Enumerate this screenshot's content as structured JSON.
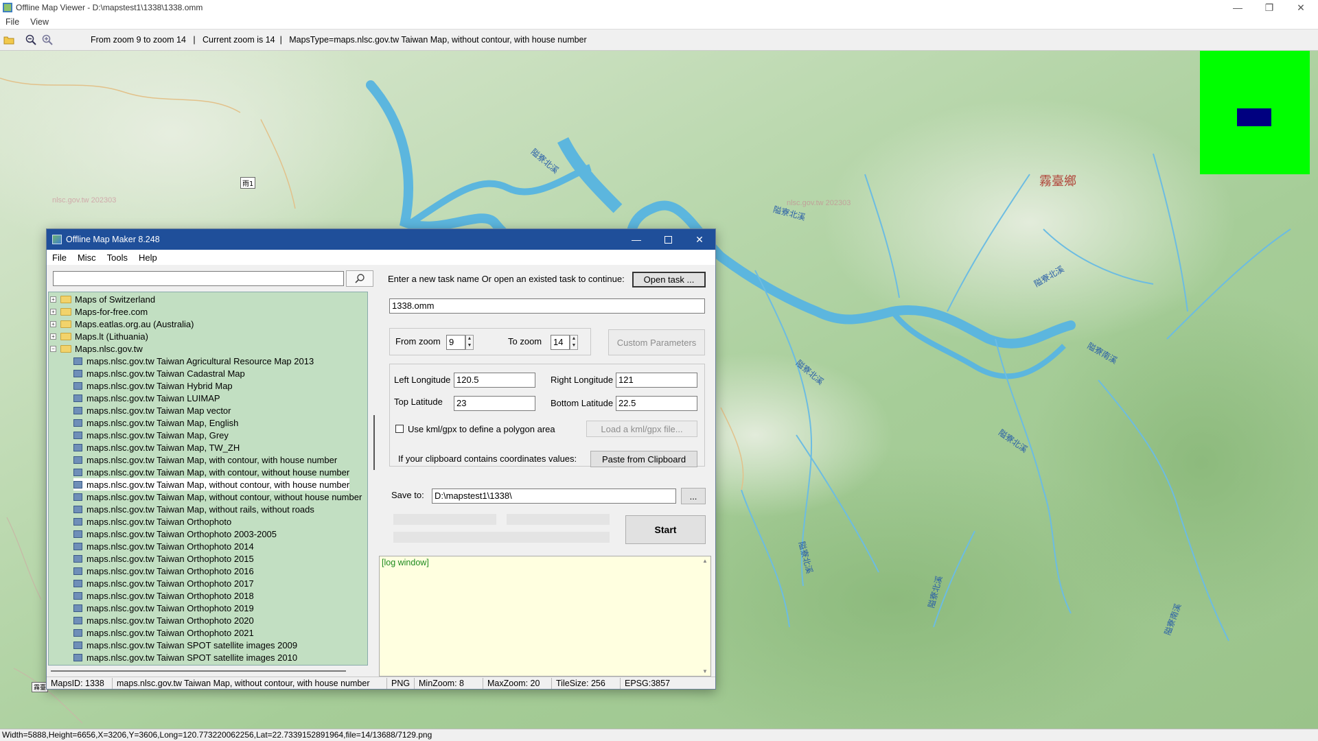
{
  "window": {
    "title": "Offline Map Viewer - D:\\mapstest1\\1338\\1338.omm",
    "min": "—",
    "max": "❐",
    "close": "✕"
  },
  "menu": [
    "File",
    "View"
  ],
  "toolbar": {
    "info": "From zoom 9 to zoom 14   |   Current zoom is 14  |   MapsType=maps.nlsc.gov.tw Taiwan Map, without contour, with house number"
  },
  "status": "Width=5888,Height=6656,X=3206,Y=3606,Long=120.773220062256,Lat=22.7339152891964,file=14/13688/7129.png",
  "map": {
    "labels": [
      "霧臺鄉",
      "隘寮北溪",
      "隘寮北溪",
      "隘寮北溪",
      "隘寮北溪",
      "隘寮北溪",
      "隘寮北溪",
      "隘寮北溪",
      "隘寮南溪",
      "隘寮南溪"
    ],
    "watermarks": [
      "nlsc.gov.tw 202303",
      "nlsc.gov.tw 202303"
    ],
    "road": "雨1",
    "road2": "霧臺"
  },
  "dialog": {
    "title": "Offline Map Maker 8.248",
    "menu": [
      "File",
      "Misc",
      "Tools",
      "Help"
    ],
    "search_value": "",
    "tree": [
      {
        "label": "Maps of Switzerland",
        "type": "folder"
      },
      {
        "label": "Maps-for-free.com",
        "type": "folder"
      },
      {
        "label": "Maps.eatlas.org.au (Australia)",
        "type": "folder"
      },
      {
        "label": "Maps.lt (Lithuania)",
        "type": "folder"
      },
      {
        "label": "Maps.nlsc.gov.tw",
        "type": "folder-open"
      },
      {
        "label": "maps.nlsc.gov.tw Taiwan Agricultural Resource Map 2013",
        "type": "map"
      },
      {
        "label": "maps.nlsc.gov.tw Taiwan Cadastral Map",
        "type": "map"
      },
      {
        "label": "maps.nlsc.gov.tw Taiwan Hybrid Map",
        "type": "map"
      },
      {
        "label": "maps.nlsc.gov.tw Taiwan LUIMAP",
        "type": "map"
      },
      {
        "label": "maps.nlsc.gov.tw Taiwan Map vector",
        "type": "map"
      },
      {
        "label": "maps.nlsc.gov.tw Taiwan Map, English",
        "type": "map"
      },
      {
        "label": "maps.nlsc.gov.tw Taiwan Map, Grey",
        "type": "map"
      },
      {
        "label": "maps.nlsc.gov.tw Taiwan Map, TW_ZH",
        "type": "map"
      },
      {
        "label": "maps.nlsc.gov.tw Taiwan Map, with contour, with house number",
        "type": "map"
      },
      {
        "label": "maps.nlsc.gov.tw Taiwan Map, with contour, without house number",
        "type": "map"
      },
      {
        "label": "maps.nlsc.gov.tw Taiwan Map, without contour, with house number",
        "type": "map",
        "selected": true
      },
      {
        "label": "maps.nlsc.gov.tw Taiwan Map, without contour, without house number",
        "type": "map"
      },
      {
        "label": "maps.nlsc.gov.tw Taiwan Map, without rails, without roads",
        "type": "map"
      },
      {
        "label": "maps.nlsc.gov.tw Taiwan Orthophoto",
        "type": "map"
      },
      {
        "label": "maps.nlsc.gov.tw Taiwan Orthophoto 2003-2005",
        "type": "map"
      },
      {
        "label": "maps.nlsc.gov.tw Taiwan Orthophoto 2014",
        "type": "map"
      },
      {
        "label": "maps.nlsc.gov.tw Taiwan Orthophoto 2015",
        "type": "map"
      },
      {
        "label": "maps.nlsc.gov.tw Taiwan Orthophoto 2016",
        "type": "map"
      },
      {
        "label": "maps.nlsc.gov.tw Taiwan Orthophoto 2017",
        "type": "map"
      },
      {
        "label": "maps.nlsc.gov.tw Taiwan Orthophoto 2018",
        "type": "map"
      },
      {
        "label": "maps.nlsc.gov.tw Taiwan Orthophoto 2019",
        "type": "map"
      },
      {
        "label": "maps.nlsc.gov.tw Taiwan Orthophoto 2020",
        "type": "map"
      },
      {
        "label": "maps.nlsc.gov.tw Taiwan Orthophoto 2021",
        "type": "map"
      },
      {
        "label": "maps.nlsc.gov.tw Taiwan SPOT satellite images 2009",
        "type": "map"
      },
      {
        "label": "maps.nlsc.gov.tw Taiwan SPOT satellite images 2010",
        "type": "map"
      }
    ],
    "task_prompt": "Enter a new task name Or open an existed task to continue:",
    "open_task": "Open task ...",
    "task_name": "1338.omm",
    "from_zoom_label": "From zoom",
    "from_zoom": "9",
    "to_zoom_label": "To zoom",
    "to_zoom": "14",
    "custom_params": "Custom Parameters",
    "left_lon_label": "Left Longitude",
    "left_lon": "120.5",
    "right_lon_label": "Right Longitude",
    "right_lon": "121",
    "top_lat_label": "Top Latitude",
    "top_lat": "23",
    "bottom_lat_label": "Bottom Latitude",
    "bottom_lat": "22.5",
    "kml_label": "Use kml/gpx to define a polygon area",
    "kml_btn": "Load a kml/gpx file...",
    "clipboard_label": "If your clipboard contains coordinates values:",
    "clipboard_btn": "Paste from Clipboard",
    "save_label": "Save to:",
    "save_path": "D:\\mapstest1\\1338\\",
    "browse": "...",
    "start": "Start",
    "log": "[log window]",
    "status": [
      "MapsID: 1338",
      "maps.nlsc.gov.tw Taiwan Map, without contour, with house number",
      "PNG",
      "MinZoom: 8",
      "MaxZoom: 20",
      "TileSize: 256",
      "EPSG:3857"
    ]
  }
}
